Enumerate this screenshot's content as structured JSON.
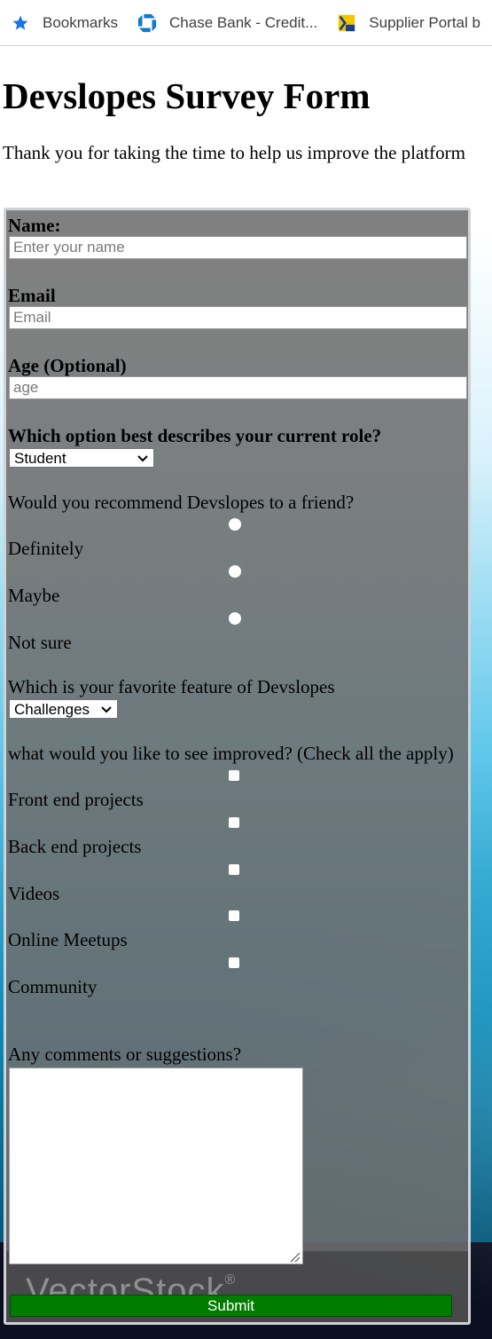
{
  "bookmarks_bar": {
    "items": [
      {
        "label": "Bookmarks",
        "icon": "star-icon"
      },
      {
        "label": "Chase Bank - Credit...",
        "icon": "chase-logo-icon"
      },
      {
        "label": "Supplier Portal b",
        "icon": "supplier-portal-icon"
      }
    ]
  },
  "page": {
    "title": "Devslopes Survey Form",
    "subtitle": "Thank you for taking the time to help us improve the platform"
  },
  "form": {
    "name_label": "Name:",
    "name_placeholder": "Enter your name",
    "email_label": "Email",
    "email_placeholder": "Email",
    "age_label": "Age (Optional)",
    "age_placeholder": "age",
    "role_label": "Which option best describes your current role?",
    "role_selected": "Student",
    "recommend_label": "Would you recommend Devslopes to a friend?",
    "recommend_options": [
      "Definitely",
      "Maybe",
      "Not sure"
    ],
    "feature_label": "Which is your favorite feature of Devslopes",
    "feature_selected": "Challenges",
    "improve_label": "what would you like to see improved? (Check all the apply)",
    "improve_options": [
      "Front end projects",
      "Back end projects",
      "Videos",
      "Online Meetups",
      "Community"
    ],
    "comments_label": "Any comments or suggestions?",
    "submit_label": "Submit",
    "watermark_text": "VectorStock",
    "watermark_mark": "®"
  },
  "colors": {
    "submit_bg": "#007c00",
    "bookmark_star": "#1a73e8",
    "chase_blue": "#117aca"
  }
}
